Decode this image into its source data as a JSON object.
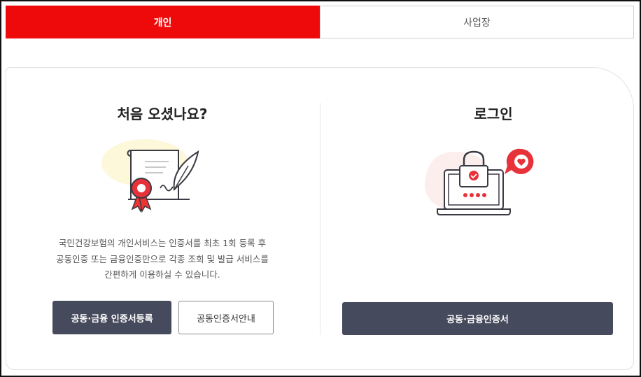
{
  "tabs": {
    "personal": "개인",
    "business": "사업장"
  },
  "left": {
    "title": "처음 오셨나요?",
    "description_lines": [
      "국민건강보험의 개인서비스는 인증서를 최초 1회 등록 후",
      "공동인증 또는 금융인증만으로 각종 조회 및 발급 서비스를",
      "간편하게 이용하실 수 있습니다."
    ],
    "register_button": "공동·금융 인증서등록",
    "guide_button": "공동인증서안내",
    "illustration_icon": "certificate-icon"
  },
  "right": {
    "title": "로그인",
    "login_button": "공동·금융인증서",
    "illustration_icon": "laptop-lock-icon"
  },
  "colors": {
    "accent": "#ee0a0a",
    "button_dark": "#454a5c"
  }
}
